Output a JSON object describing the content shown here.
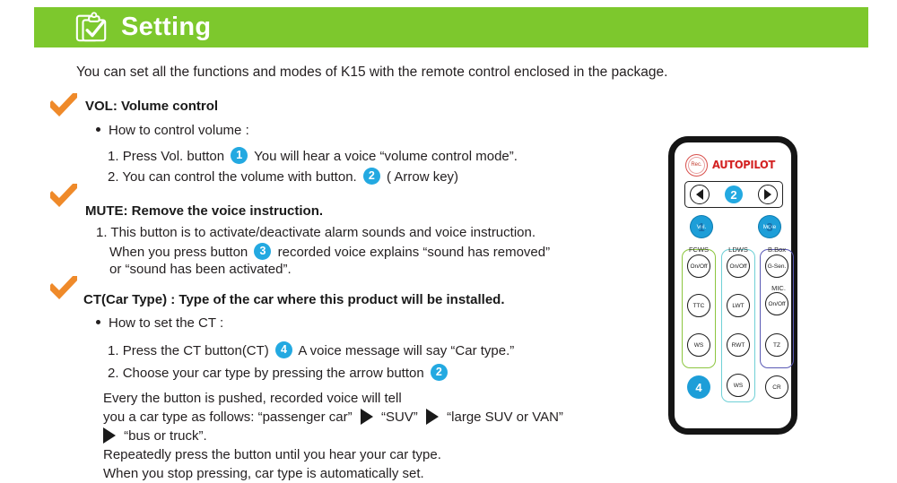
{
  "header": {
    "title": "Setting",
    "icon": "clipboard-check-icon",
    "bar_color": "#7dc82d"
  },
  "intro": "You can set all the functions and modes of K15 with the remote control enclosed in the package.",
  "accent": {
    "check_color": "#ef8a2a",
    "badge_color": "#23a9e1",
    "logo_color": "#d32121"
  },
  "sections": [
    {
      "check_icon": "orange-check-icon",
      "heading": "VOL: Volume control",
      "bullet": "How to control volume :",
      "steps": [
        {
          "number": "1.",
          "text_before": "Press Vol. button",
          "badge": "1",
          "text_after": "You will hear a voice “volume control mode”."
        },
        {
          "number": "2.",
          "text_before": "You can control the volume with button.",
          "badge": "2",
          "text_after": "( Arrow key)"
        }
      ]
    },
    {
      "check_icon": "orange-check-icon",
      "heading": "MUTE: Remove the voice instruction.",
      "steps": [
        {
          "number": "1.",
          "line1": "This button is to activate/deactivate alarm sounds and voice instruction.",
          "line2_before": "When you press button",
          "badge": "3",
          "line2_after": "recorded voice explains “sound has removed”",
          "line3": "or “sound has been activated”."
        }
      ]
    },
    {
      "check_icon": "orange-check-icon",
      "heading": "CT(Car Type) : Type of the car where this product will be installed.",
      "bullet": "How to set the CT :",
      "steps": [
        {
          "number": "1.",
          "text_before": "Press the CT button(CT)",
          "badge": "4",
          "text_after": "A voice message will say “Car type.”"
        },
        {
          "number": "2.",
          "text_before": "Choose your car type by pressing the arrow button",
          "badge": "2",
          "text_after": ""
        }
      ],
      "note": {
        "line1": "Every the button is pushed, recorded voice will tell",
        "line2_a": "you a car type as follows: “passenger car”",
        "line2_b": "“SUV”",
        "line2_c": "“large SUV or VAN”",
        "line3": "“bus or truck”.",
        "line4": "Repeatedly press the button until you hear your car type.",
        "line5": "When you stop pressing, car type is automatically set."
      }
    }
  ],
  "remote": {
    "rec_label": "Rec.",
    "brand": "AUTOPILOT",
    "arrow_badge": "2",
    "left_arrow": "left-arrow-icon",
    "right_arrow": "right-arrow-icon",
    "vol_button": {
      "label": "Vol.",
      "badge": "1"
    },
    "mute_button": {
      "label": "Mute",
      "badge": "3"
    },
    "groups": [
      {
        "label": "FCWS",
        "color": "#8cc63f"
      },
      {
        "label": "LDWS",
        "color": "#6fd0d6"
      },
      {
        "label": "B.Box",
        "color": "#5a5ab5"
      }
    ],
    "mic_label": "MIC.",
    "col1": [
      "On/Off",
      "TTC",
      "WS"
    ],
    "col2": [
      "On/Off",
      "LWT",
      "RWT",
      "WS"
    ],
    "col3": [
      "G-Sen.",
      "On/Off",
      "TZ",
      "CR"
    ],
    "ct_badge": "4"
  }
}
